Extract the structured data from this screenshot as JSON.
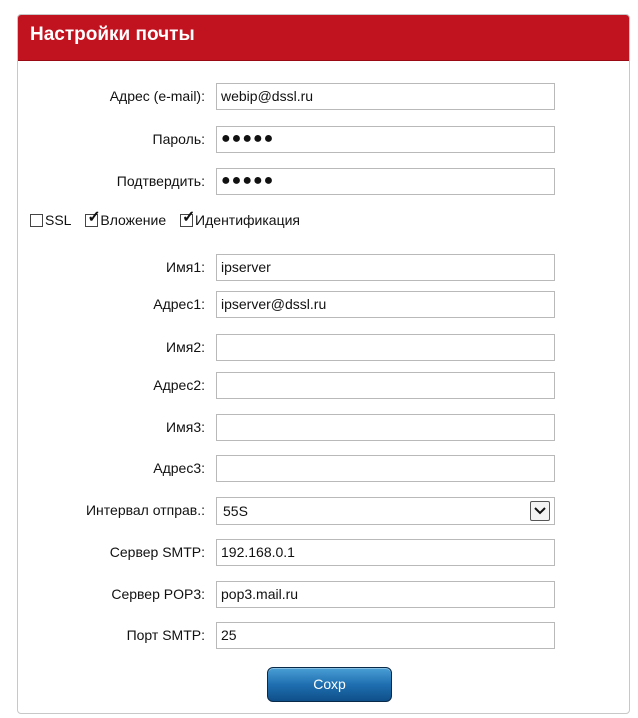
{
  "header": {
    "title": "Настройки почты"
  },
  "form": {
    "email": {
      "label": "Адрес (e-mail):",
      "value": "webip@dssl.ru"
    },
    "password": {
      "label": "Пароль:",
      "value": "●●●●●"
    },
    "confirm": {
      "label": "Подтвердить:",
      "value": "●●●●●"
    },
    "options": {
      "ssl": {
        "label": "SSL",
        "checked": false
      },
      "attachment": {
        "label": "Вложение",
        "checked": true
      },
      "auth": {
        "label": "Идентификация",
        "checked": true
      }
    },
    "name1": {
      "label": "Имя1:",
      "value": "ipserver"
    },
    "addr1": {
      "label": "Адрес1:",
      "value": "ipserver@dssl.ru"
    },
    "name2": {
      "label": "Имя2:",
      "value": ""
    },
    "addr2": {
      "label": "Адрес2:",
      "value": ""
    },
    "name3": {
      "label": "Имя3:",
      "value": ""
    },
    "addr3": {
      "label": "Адрес3:",
      "value": ""
    },
    "interval": {
      "label": "Интервал отправ.:",
      "value": "55S"
    },
    "smtp_server": {
      "label": "Сервер SMTP:",
      "value": "192.168.0.1"
    },
    "pop3_server": {
      "label": "Сервер POP3:",
      "value": "pop3.mail.ru"
    },
    "smtp_port": {
      "label": "Порт SMTP:",
      "value": "25"
    }
  },
  "actions": {
    "save_label": "Сохр"
  },
  "colors": {
    "header_bg": "#c1121f",
    "button": "#1f6fb0"
  }
}
